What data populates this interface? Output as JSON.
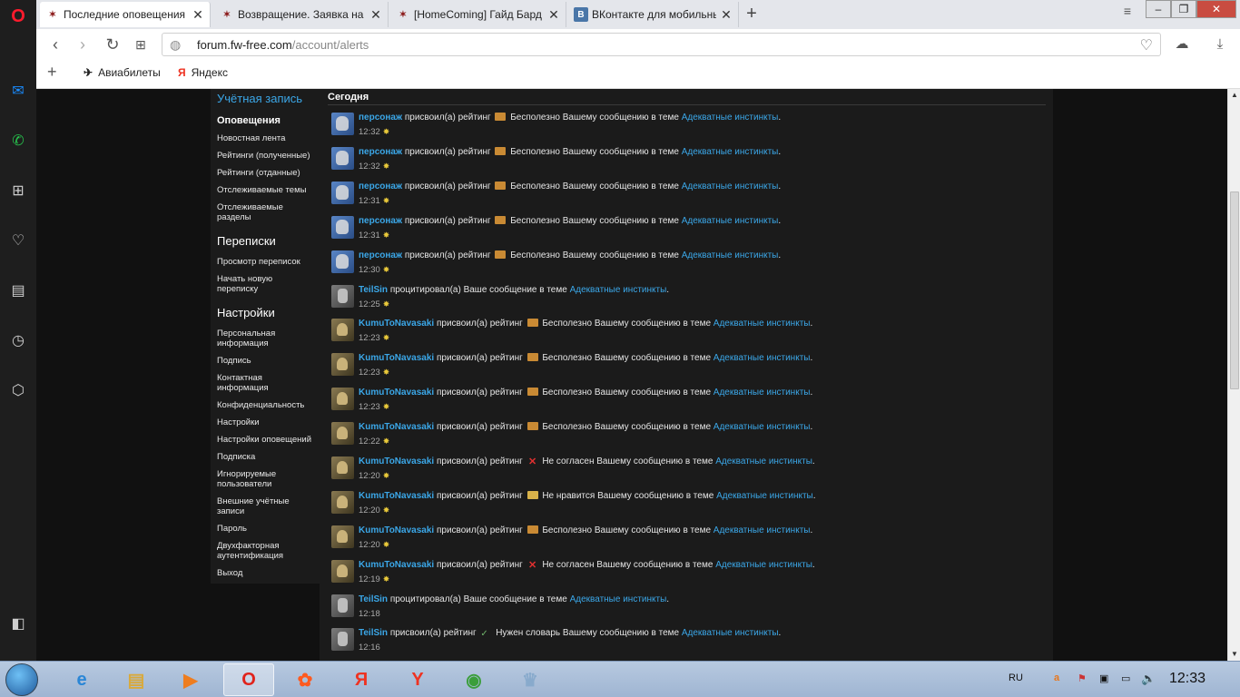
{
  "tabs": [
    {
      "title": "Последние оповещения | FW-Free",
      "favicon": "fw-icon",
      "active": true
    },
    {
      "title": "Возвращение. Заявка на добавление",
      "favicon": "fw-icon",
      "active": false
    },
    {
      "title": "[HomeComing] Гайд Бард С",
      "favicon": "fw-icon",
      "active": false
    },
    {
      "title": "ВКонтакте для мобильных устройств",
      "favicon": "vk-icon",
      "active": false
    }
  ],
  "address": {
    "domain": "forum.fw-free.com",
    "path": "/account/alerts"
  },
  "bookmarks": [
    {
      "label": "Авиабилеты",
      "icon": "plane-icon"
    },
    {
      "label": "Яндекс",
      "icon": "yandex-icon"
    }
  ],
  "nav": {
    "account_heading": "Учётная запись",
    "alerts": "Оповещения",
    "news_feed": "Новостная лента",
    "ratings_received": "Рейтинги (полученные)",
    "ratings_given": "Рейтинги (отданные)",
    "watched_threads": "Отслеживаемые темы",
    "watched_forums": "Отслеживаемые разделы",
    "conversations_heading": "Переписки",
    "view_conversations": "Просмотр переписок",
    "start_conversation": "Начать новую переписку",
    "settings_heading": "Настройки",
    "personal_details": "Персональная информация",
    "signature": "Подпись",
    "contact_details": "Контактная информация",
    "privacy": "Конфиденциальность",
    "preferences": "Настройки",
    "alert_preferences": "Настройки оповещений",
    "subscription": "Подписка",
    "ignored_users": "Игнорируемые пользователи",
    "external_accounts": "Внешние учётные записи",
    "password": "Пароль",
    "two_step": "Двухфакторная аутентификация",
    "logout": "Выход"
  },
  "content": {
    "section": "Сегодня"
  },
  "alerts": [
    {
      "user": "персонаж",
      "avatar": "persona",
      "action": "присвоил(а) рейтинг",
      "rating": "Бесполезно",
      "rating_icon": "useless",
      "middle": "Вашему сообщению в теме",
      "thread": "Адекватные инстинкты",
      "time": "12:32"
    },
    {
      "user": "персонаж",
      "avatar": "persona",
      "action": "присвоил(а) рейтинг",
      "rating": "Бесполезно",
      "rating_icon": "useless",
      "middle": "Вашему сообщению в теме",
      "thread": "Адекватные инстинкты",
      "time": "12:32"
    },
    {
      "user": "персонаж",
      "avatar": "persona",
      "action": "присвоил(а) рейтинг",
      "rating": "Бесполезно",
      "rating_icon": "useless",
      "middle": "Вашему сообщению в теме",
      "thread": "Адекватные инстинкты",
      "time": "12:31"
    },
    {
      "user": "персонаж",
      "avatar": "persona",
      "action": "присвоил(а) рейтинг",
      "rating": "Бесполезно",
      "rating_icon": "useless",
      "middle": "Вашему сообщению в теме",
      "thread": "Адекватные инстинкты",
      "time": "12:31"
    },
    {
      "user": "персонаж",
      "avatar": "persona",
      "action": "присвоил(а) рейтинг",
      "rating": "Бесполезно",
      "rating_icon": "useless",
      "middle": "Вашему сообщению в теме",
      "thread": "Адекватные инстинкты",
      "time": "12:30"
    },
    {
      "user": "TeilSin",
      "avatar": "teil",
      "action": "процитировал(а) Ваше сообщение в теме",
      "rating": "",
      "rating_icon": "",
      "middle": "",
      "thread": "Адекватные инстинкты",
      "time": "12:25"
    },
    {
      "user": "KumuToNavasaki",
      "avatar": "kumu",
      "action": "присвоил(а) рейтинг",
      "rating": "Бесполезно",
      "rating_icon": "useless",
      "middle": "Вашему сообщению в теме",
      "thread": "Адекватные инстинкты",
      "time": "12:23"
    },
    {
      "user": "KumuToNavasaki",
      "avatar": "kumu",
      "action": "присвоил(а) рейтинг",
      "rating": "Бесполезно",
      "rating_icon": "useless",
      "middle": "Вашему сообщению в теме",
      "thread": "Адекватные инстинкты",
      "time": "12:23"
    },
    {
      "user": "KumuToNavasaki",
      "avatar": "kumu",
      "action": "присвоил(а) рейтинг",
      "rating": "Бесполезно",
      "rating_icon": "useless",
      "middle": "Вашему сообщению в теме",
      "thread": "Адекватные инстинкты",
      "time": "12:23"
    },
    {
      "user": "KumuToNavasaki",
      "avatar": "kumu",
      "action": "присвоил(а) рейтинг",
      "rating": "Бесполезно",
      "rating_icon": "useless",
      "middle": "Вашему сообщению в теме",
      "thread": "Адекватные инстинкты",
      "time": "12:22"
    },
    {
      "user": "KumuToNavasaki",
      "avatar": "kumu",
      "action": "присвоил(а) рейтинг",
      "rating": "Не согласен",
      "rating_icon": "disagree",
      "middle": "Вашему сообщению в теме",
      "thread": "Адекватные инстинкты",
      "time": "12:20"
    },
    {
      "user": "KumuToNavasaki",
      "avatar": "kumu",
      "action": "присвоил(а) рейтинг",
      "rating": "Не нравится",
      "rating_icon": "dislike",
      "middle": "Вашему сообщению в теме",
      "thread": "Адекватные инстинкты",
      "time": "12:20"
    },
    {
      "user": "KumuToNavasaki",
      "avatar": "kumu",
      "action": "присвоил(а) рейтинг",
      "rating": "Бесполезно",
      "rating_icon": "useless",
      "middle": "Вашему сообщению в теме",
      "thread": "Адекватные инстинкты",
      "time": "12:20"
    },
    {
      "user": "KumuToNavasaki",
      "avatar": "kumu",
      "action": "присвоил(а) рейтинг",
      "rating": "Не согласен",
      "rating_icon": "disagree",
      "middle": "Вашему сообщению в теме",
      "thread": "Адекватные инстинкты",
      "time": "12:19"
    },
    {
      "user": "TeilSin",
      "avatar": "teil",
      "action": "процитировал(а) Ваше сообщение в теме",
      "rating": "",
      "rating_icon": "",
      "middle": "",
      "thread": "Адекватные инстинкты",
      "time": "12:18"
    },
    {
      "user": "TeilSin",
      "avatar": "teil",
      "action": "присвоил(а) рейтинг",
      "rating": "Нужен словарь",
      "rating_icon": "vocab",
      "middle": "Вашему сообщению в теме",
      "thread": "Адекватные инстинкты",
      "time": "12:16"
    }
  ],
  "taskbar": {
    "language": "RU",
    "clock": "12:33"
  },
  "colors": {
    "link": "#3ba7e8",
    "page_bg": "#111111",
    "panel_bg": "#1b1b1b",
    "opera_red": "#ff1b2d"
  }
}
